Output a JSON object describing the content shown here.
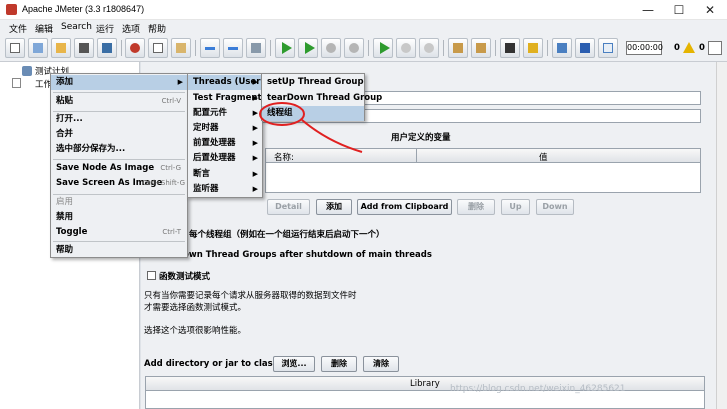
{
  "window": {
    "title": "Apache JMeter (3.3 r1808647)",
    "controls": [
      "—",
      "☐",
      "✕"
    ]
  },
  "menubar": [
    "文件",
    "编辑",
    "Search",
    "运行",
    "选项",
    "帮助"
  ],
  "toolbar": {
    "timer": "00:00:00",
    "warn_count": "0",
    "thread_count": "0"
  },
  "tree": {
    "root": "测试计划",
    "child": "工作"
  },
  "context_menu": {
    "items": [
      {
        "label": "添加",
        "submenu": true,
        "highlight": true
      },
      {
        "label": "粘贴",
        "shortcut": "Ctrl-V"
      },
      {
        "label": "打开..."
      },
      {
        "label": "合并"
      },
      {
        "label": "选中部分保存为..."
      },
      {
        "label": "Save Node As Image",
        "shortcut": "Ctrl-G"
      },
      {
        "label": "Save Screen As Image",
        "shortcut": "Ctrl+Shift-G"
      },
      {
        "label": "启用",
        "disabled": true
      },
      {
        "label": "禁用"
      },
      {
        "label": "Toggle",
        "shortcut": "Ctrl-T"
      },
      {
        "label": "帮助"
      }
    ]
  },
  "add_submenu": [
    "Threads (Users)",
    "Test Fragment",
    "配置元件",
    "定时器",
    "前置处理器",
    "后置处理器",
    "断言",
    "监听器"
  ],
  "threads_submenu": [
    "setUp Thread Group",
    "tearDown Thread Group",
    "线程组"
  ],
  "panel": {
    "heading_partial": "测试计划",
    "user_vars_title": "用户定义的变量",
    "col_name": "名称:",
    "col_value": "值",
    "buttons": {
      "detail": "Detail",
      "add": "添加",
      "clipboard": "Add from Clipboard",
      "delete": "删除",
      "up": "Up",
      "down": "Down"
    },
    "run_sequential": "每个线程组（例如在一个组运行结束后启动下一个）",
    "teardown": "Down Thread Groups after shutdown of main threads",
    "functional_mode": "函数测试模式",
    "note1": "只有当你需要记录每个请求从服务器取得的数据到文件时",
    "note2": "才需要选择函数测试模式。",
    "note3": "选择这个选项很影响性能。",
    "classpath_label": "Add directory or jar to classpath",
    "browse": "浏览...",
    "cp_delete": "删除",
    "cp_clear": "清除",
    "library": "Library"
  },
  "watermark": "https://blog.csdn.net/weixin_46285621"
}
